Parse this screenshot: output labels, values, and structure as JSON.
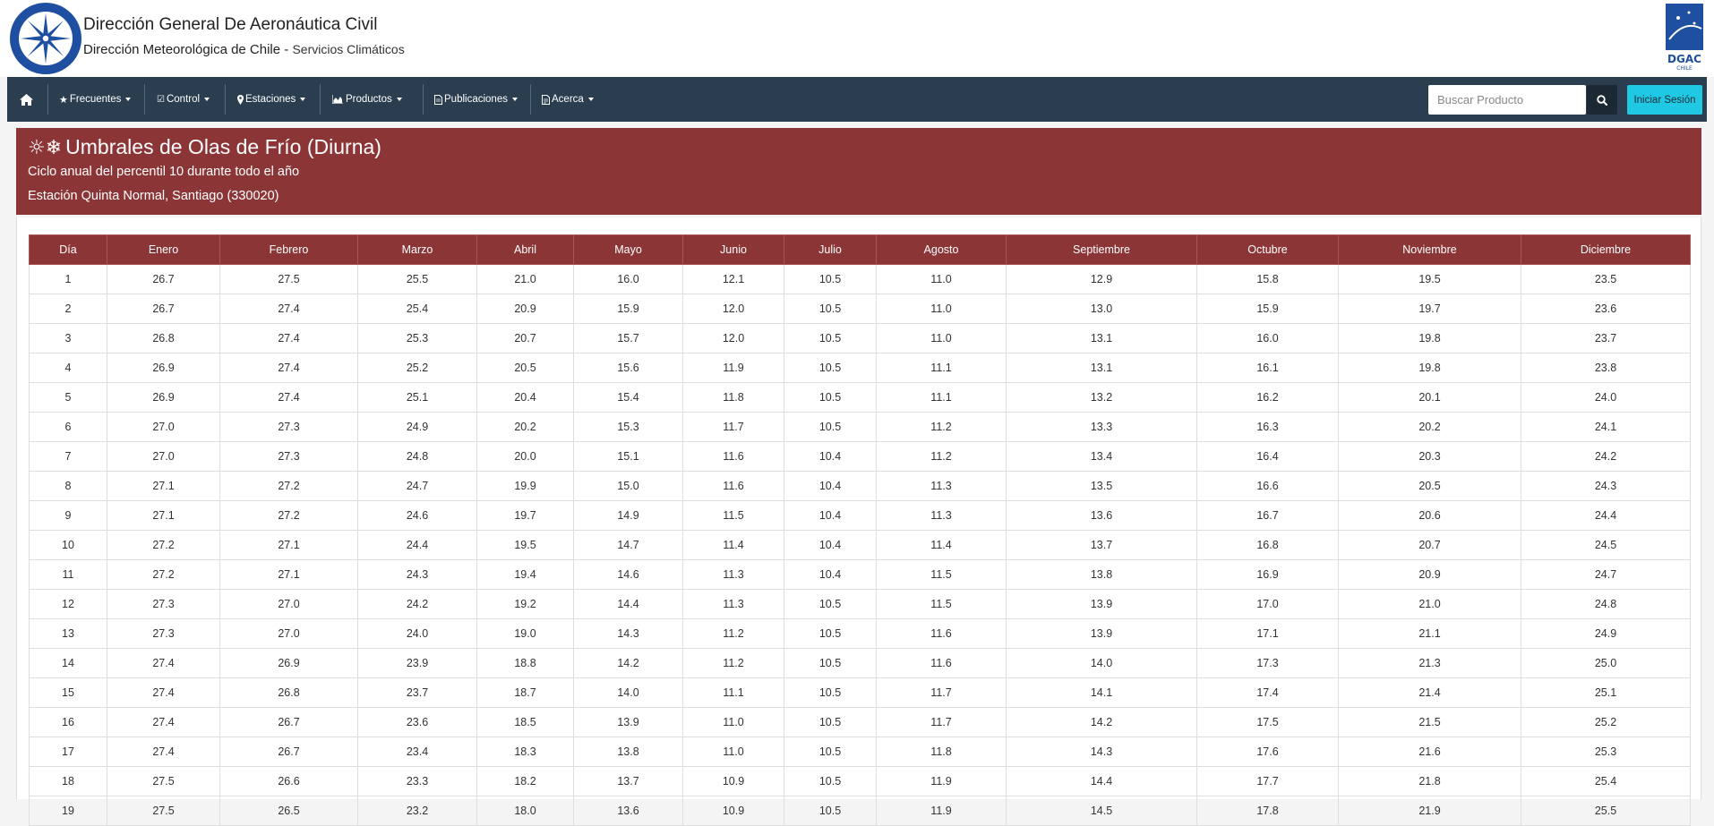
{
  "header": {
    "title": "Dirección General De Aeronáutica Civil",
    "subtitle": "Dirección Meteorológica de Chile",
    "subtitle_sep": " - ",
    "subtitle_small": "Servicios Climáticos",
    "logo_left": "meteochile-seal-icon",
    "logo_right": "dgac-chile-logo"
  },
  "nav": {
    "items": [
      {
        "label": "Frecuentes",
        "icon": "star-icon"
      },
      {
        "label": "Control",
        "icon": "check-square-icon"
      },
      {
        "label": "Estaciones",
        "icon": "map-marker-icon"
      },
      {
        "label": "Productos",
        "icon": "area-chart-icon"
      },
      {
        "label": "Publicaciones",
        "icon": "file-icon"
      },
      {
        "label": "Acerca",
        "icon": "file-text-icon"
      }
    ],
    "search_placeholder": "Buscar Producto",
    "login_label": "Iniciar Sesión"
  },
  "panel": {
    "symbols": "☼❄",
    "title": "Umbrales de Olas de Frío (Diurna)",
    "line1": "Ciclo anual del percentil 10 durante todo el año",
    "line2": "Estación Quinta Normal, Santiago (330020)"
  },
  "colors": {
    "navbar": "#2b3e50",
    "panel": "#8c3537",
    "login": "#1fc8e3"
  },
  "table": {
    "headers": [
      "Día",
      "Enero",
      "Febrero",
      "Marzo",
      "Abril",
      "Mayo",
      "Junio",
      "Julio",
      "Agosto",
      "Septiembre",
      "Octubre",
      "Noviembre",
      "Diciembre"
    ],
    "rows": [
      [
        "1",
        "26.7",
        "27.5",
        "25.5",
        "21.0",
        "16.0",
        "12.1",
        "10.5",
        "11.0",
        "12.9",
        "15.8",
        "19.5",
        "23.5"
      ],
      [
        "2",
        "26.7",
        "27.4",
        "25.4",
        "20.9",
        "15.9",
        "12.0",
        "10.5",
        "11.0",
        "13.0",
        "15.9",
        "19.7",
        "23.6"
      ],
      [
        "3",
        "26.8",
        "27.4",
        "25.3",
        "20.7",
        "15.7",
        "12.0",
        "10.5",
        "11.0",
        "13.1",
        "16.0",
        "19.8",
        "23.7"
      ],
      [
        "4",
        "26.9",
        "27.4",
        "25.2",
        "20.5",
        "15.6",
        "11.9",
        "10.5",
        "11.1",
        "13.1",
        "16.1",
        "19.8",
        "23.8"
      ],
      [
        "5",
        "26.9",
        "27.4",
        "25.1",
        "20.4",
        "15.4",
        "11.8",
        "10.5",
        "11.1",
        "13.2",
        "16.2",
        "20.1",
        "24.0"
      ],
      [
        "6",
        "27.0",
        "27.3",
        "24.9",
        "20.2",
        "15.3",
        "11.7",
        "10.5",
        "11.2",
        "13.3",
        "16.3",
        "20.2",
        "24.1"
      ],
      [
        "7",
        "27.0",
        "27.3",
        "24.8",
        "20.0",
        "15.1",
        "11.6",
        "10.4",
        "11.2",
        "13.4",
        "16.4",
        "20.3",
        "24.2"
      ],
      [
        "8",
        "27.1",
        "27.2",
        "24.7",
        "19.9",
        "15.0",
        "11.6",
        "10.4",
        "11.3",
        "13.5",
        "16.6",
        "20.5",
        "24.3"
      ],
      [
        "9",
        "27.1",
        "27.2",
        "24.6",
        "19.7",
        "14.9",
        "11.5",
        "10.4",
        "11.3",
        "13.6",
        "16.7",
        "20.6",
        "24.4"
      ],
      [
        "10",
        "27.2",
        "27.1",
        "24.4",
        "19.5",
        "14.7",
        "11.4",
        "10.4",
        "11.4",
        "13.7",
        "16.8",
        "20.7",
        "24.5"
      ],
      [
        "11",
        "27.2",
        "27.1",
        "24.3",
        "19.4",
        "14.6",
        "11.3",
        "10.4",
        "11.5",
        "13.8",
        "16.9",
        "20.9",
        "24.7"
      ],
      [
        "12",
        "27.3",
        "27.0",
        "24.2",
        "19.2",
        "14.4",
        "11.3",
        "10.5",
        "11.5",
        "13.9",
        "17.0",
        "21.0",
        "24.8"
      ],
      [
        "13",
        "27.3",
        "27.0",
        "24.0",
        "19.0",
        "14.3",
        "11.2",
        "10.5",
        "11.6",
        "13.9",
        "17.1",
        "21.1",
        "24.9"
      ],
      [
        "14",
        "27.4",
        "26.9",
        "23.9",
        "18.8",
        "14.2",
        "11.2",
        "10.5",
        "11.6",
        "14.0",
        "17.3",
        "21.3",
        "25.0"
      ],
      [
        "15",
        "27.4",
        "26.8",
        "23.7",
        "18.7",
        "14.0",
        "11.1",
        "10.5",
        "11.7",
        "14.1",
        "17.4",
        "21.4",
        "25.1"
      ],
      [
        "16",
        "27.4",
        "26.7",
        "23.6",
        "18.5",
        "13.9",
        "11.0",
        "10.5",
        "11.7",
        "14.2",
        "17.5",
        "21.5",
        "25.2"
      ],
      [
        "17",
        "27.4",
        "26.7",
        "23.4",
        "18.3",
        "13.8",
        "11.0",
        "10.5",
        "11.8",
        "14.3",
        "17.6",
        "21.6",
        "25.3"
      ],
      [
        "18",
        "27.5",
        "26.6",
        "23.3",
        "18.2",
        "13.7",
        "10.9",
        "10.5",
        "11.9",
        "14.4",
        "17.7",
        "21.8",
        "25.4"
      ],
      [
        "19",
        "27.5",
        "26.5",
        "23.2",
        "18.0",
        "13.6",
        "10.9",
        "10.5",
        "11.9",
        "14.5",
        "17.8",
        "21.9",
        "25.5"
      ]
    ]
  }
}
